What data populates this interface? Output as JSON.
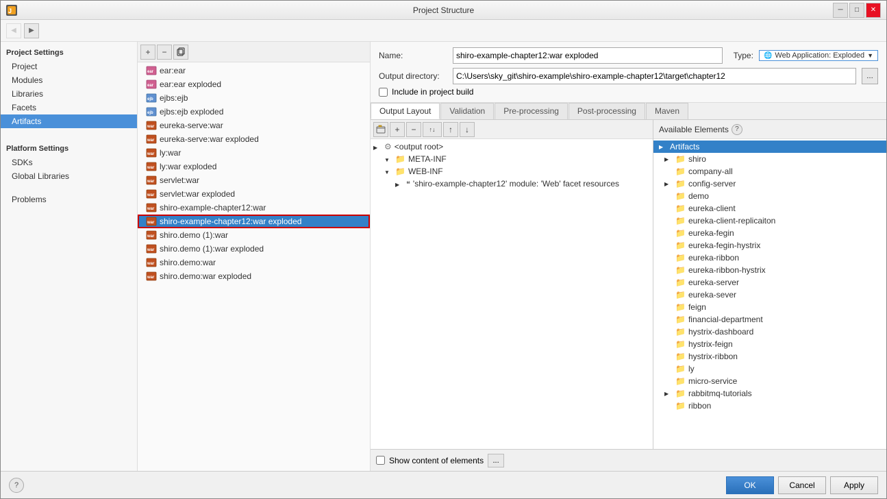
{
  "window": {
    "title": "Project Structure",
    "icon": "intellij-icon"
  },
  "toolbar": {
    "back_label": "◀",
    "forward_label": "▶"
  },
  "sidebar": {
    "project_settings_label": "Project Settings",
    "items": [
      {
        "id": "project",
        "label": "Project"
      },
      {
        "id": "modules",
        "label": "Modules"
      },
      {
        "id": "libraries",
        "label": "Libraries"
      },
      {
        "id": "facets",
        "label": "Facets"
      },
      {
        "id": "artifacts",
        "label": "Artifacts",
        "active": true
      }
    ],
    "platform_settings_label": "Platform Settings",
    "platform_items": [
      {
        "id": "sdks",
        "label": "SDKs"
      },
      {
        "id": "global-libraries",
        "label": "Global Libraries"
      }
    ],
    "problems_label": "Problems"
  },
  "left_panel": {
    "artifacts": [
      {
        "id": "ear-ear",
        "label": "ear:ear",
        "type": "ear"
      },
      {
        "id": "ear-ear-exploded",
        "label": "ear:ear exploded",
        "type": "ear"
      },
      {
        "id": "ejbs-ejb",
        "label": "ejbs:ejb",
        "type": "ejb"
      },
      {
        "id": "ejbs-ejb-exploded",
        "label": "ejbs:ejb exploded",
        "type": "ejb"
      },
      {
        "id": "eureka-serve-war",
        "label": "eureka-serve:war",
        "type": "war"
      },
      {
        "id": "eureka-serve-war-exploded",
        "label": "eureka-serve:war exploded",
        "type": "war"
      },
      {
        "id": "ly-war",
        "label": "ly:war",
        "type": "war"
      },
      {
        "id": "ly-war-exploded",
        "label": "ly:war exploded",
        "type": "war"
      },
      {
        "id": "servlet-war",
        "label": "servlet:war",
        "type": "war"
      },
      {
        "id": "servlet-war-exploded",
        "label": "servlet:war exploded",
        "type": "war"
      },
      {
        "id": "shiro-example-chapter12-war",
        "label": "shiro-example-chapter12:war",
        "type": "war"
      },
      {
        "id": "shiro-example-chapter12-war-exploded",
        "label": "shiro-example-chapter12:war exploded",
        "type": "war",
        "selected": true
      },
      {
        "id": "shiro-demo-1-war",
        "label": "shiro.demo (1):war",
        "type": "war"
      },
      {
        "id": "shiro-demo-1-war-exploded",
        "label": "shiro.demo (1):war exploded",
        "type": "war"
      },
      {
        "id": "shiro-demo-war",
        "label": "shiro.demo:war",
        "type": "war"
      },
      {
        "id": "shiro-demo-war-exploded",
        "label": "shiro.demo:war exploded",
        "type": "war"
      }
    ]
  },
  "right_panel": {
    "name_label": "Name:",
    "name_value": "shiro-example-chapter12:war exploded",
    "type_label": "Type:",
    "type_value": "Web Application: Exploded",
    "output_dir_label": "Output directory:",
    "output_dir_value": "C:\\Users\\sky_git\\shiro-example\\shiro-example-chapter12\\target\\chapter12",
    "include_in_project_build": "Include in project build",
    "tabs": [
      {
        "id": "output-layout",
        "label": "Output Layout",
        "active": true
      },
      {
        "id": "validation",
        "label": "Validation"
      },
      {
        "id": "pre-processing",
        "label": "Pre-processing"
      },
      {
        "id": "post-processing",
        "label": "Post-processing"
      },
      {
        "id": "maven",
        "label": "Maven"
      }
    ],
    "tree": [
      {
        "id": "output-root",
        "label": "<output root>",
        "icon": "output-icon",
        "indent": 0,
        "chevron": "right"
      },
      {
        "id": "meta-inf",
        "label": "META-INF",
        "icon": "folder",
        "indent": 1,
        "chevron": "down"
      },
      {
        "id": "web-inf",
        "label": "WEB-INF",
        "icon": "folder",
        "indent": 1,
        "chevron": "down"
      },
      {
        "id": "shiro-module",
        "label": "'shiro-example-chapter12' module: 'Web' facet resources",
        "icon": "module",
        "indent": 2,
        "chevron": "right"
      }
    ],
    "available_elements_label": "Available Elements",
    "help_icon": "?",
    "available": [
      {
        "id": "artifacts-header",
        "label": "Artifacts",
        "indent": 0,
        "chevron": "right",
        "selected": true
      },
      {
        "id": "shiro",
        "label": "shiro",
        "indent": 1,
        "chevron": "right"
      },
      {
        "id": "company-all",
        "label": "company-all",
        "indent": 1,
        "chevron": "none"
      },
      {
        "id": "config-server",
        "label": "config-server",
        "indent": 1,
        "chevron": "right"
      },
      {
        "id": "demo",
        "label": "demo",
        "indent": 1,
        "chevron": "none"
      },
      {
        "id": "eureka-client",
        "label": "eureka-client",
        "indent": 1,
        "chevron": "none"
      },
      {
        "id": "eureka-client-replicaiton",
        "label": "eureka-client-replicaiton",
        "indent": 1,
        "chevron": "none"
      },
      {
        "id": "eureka-fegin",
        "label": "eureka-fegin",
        "indent": 1,
        "chevron": "none"
      },
      {
        "id": "eureka-fegin-hystrix",
        "label": "eureka-fegin-hystrix",
        "indent": 1,
        "chevron": "none"
      },
      {
        "id": "eureka-ribbon",
        "label": "eureka-ribbon",
        "indent": 1,
        "chevron": "none"
      },
      {
        "id": "eureka-ribbon-hystrix",
        "label": "eureka-ribbon-hystrix",
        "indent": 1,
        "chevron": "none"
      },
      {
        "id": "eureka-server",
        "label": "eureka-server",
        "indent": 1,
        "chevron": "none"
      },
      {
        "id": "eureka-sever",
        "label": "eureka-sever",
        "indent": 1,
        "chevron": "none"
      },
      {
        "id": "feign",
        "label": "feign",
        "indent": 1,
        "chevron": "none"
      },
      {
        "id": "financial-department",
        "label": "financial-department",
        "indent": 1,
        "chevron": "none"
      },
      {
        "id": "hystrix-dashboard",
        "label": "hystrix-dashboard",
        "indent": 1,
        "chevron": "none"
      },
      {
        "id": "hystrix-feign",
        "label": "hystrix-feign",
        "indent": 1,
        "chevron": "none"
      },
      {
        "id": "hystrix-ribbon",
        "label": "hystrix-ribbon",
        "indent": 1,
        "chevron": "none"
      },
      {
        "id": "ly",
        "label": "ly",
        "indent": 1,
        "chevron": "none"
      },
      {
        "id": "micro-service",
        "label": "micro-service",
        "indent": 1,
        "chevron": "none"
      },
      {
        "id": "rabbitmq-tutorials",
        "label": "rabbitmq-tutorials",
        "indent": 1,
        "chevron": "right"
      },
      {
        "id": "ribbon",
        "label": "ribbon",
        "indent": 1,
        "chevron": "none"
      }
    ],
    "show_content_label": "Show content of elements",
    "ellipsis_label": "...",
    "ok_label": "OK",
    "cancel_label": "Cancel",
    "apply_label": "Apply"
  }
}
